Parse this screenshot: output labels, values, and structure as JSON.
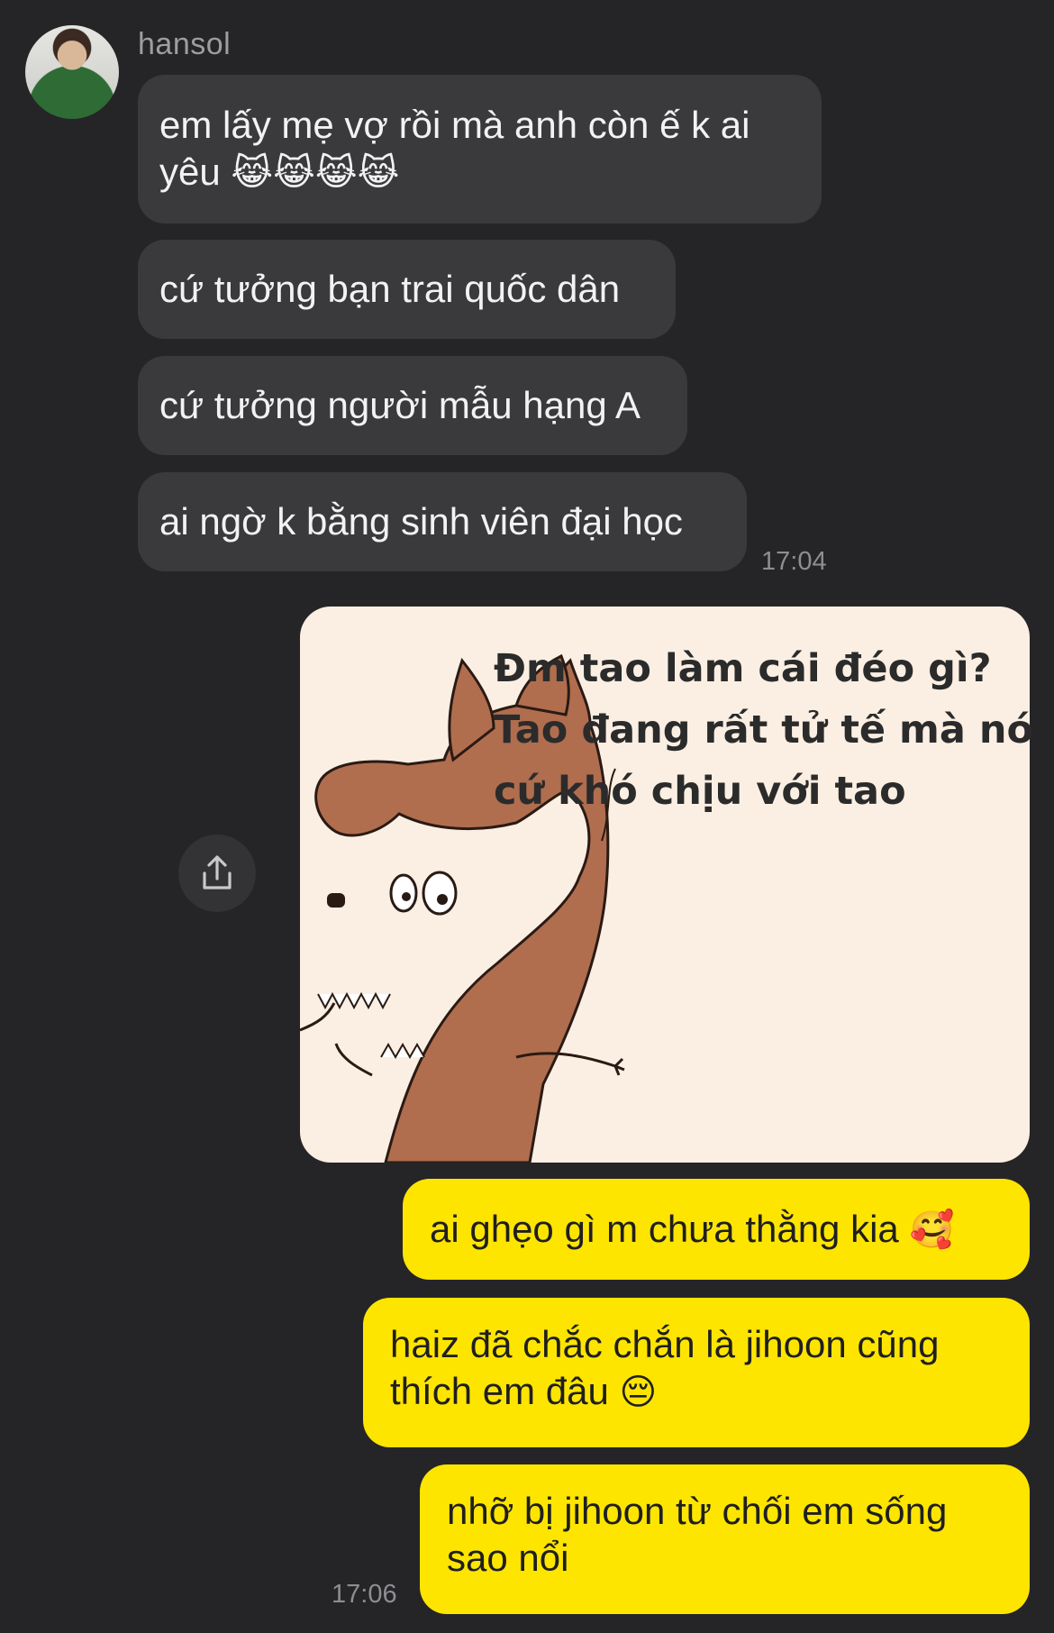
{
  "contact": {
    "name": "hansol",
    "avatar": "avatar"
  },
  "incoming": [
    {
      "text": "em lấy mẹ vợ rồi mà anh còn ế k ai yêu",
      "line1": "em lấy mẹ vợ rồi mà anh còn ế k ai",
      "line2": "yêu",
      "emoji": "😹😹😹😹"
    },
    {
      "text": "cứ tưởng bạn trai quốc dân"
    },
    {
      "text": "cứ tưởng người mẫu hạng A"
    },
    {
      "text": "ai ngờ k bằng sinh viên đại học"
    }
  ],
  "incoming_time": "17:04",
  "image_message": {
    "caption_lines": [
      "Đm tao làm cái đéo gì?",
      "Tao đang rất tử tế mà nó",
      "cứ khó chịu với tao"
    ],
    "share_icon": "share-icon"
  },
  "outgoing": [
    {
      "text": "ai ghẹo gì m chưa thằng kia",
      "emoji": "🥰"
    },
    {
      "line1": "haiz đã chắc chắn là jihoon cũng",
      "line2": "thích em đâu",
      "emoji": "😔"
    },
    {
      "line1": "nhỡ bị jihoon từ chối em sống",
      "line2": "sao nổi"
    }
  ],
  "outgoing_time": "17:06",
  "colors": {
    "background": "#252527",
    "incoming_bubble": "#3a3a3c",
    "outgoing_bubble": "#fee500",
    "meme_bg": "#fbefe3",
    "dog": "#b06e4f"
  }
}
